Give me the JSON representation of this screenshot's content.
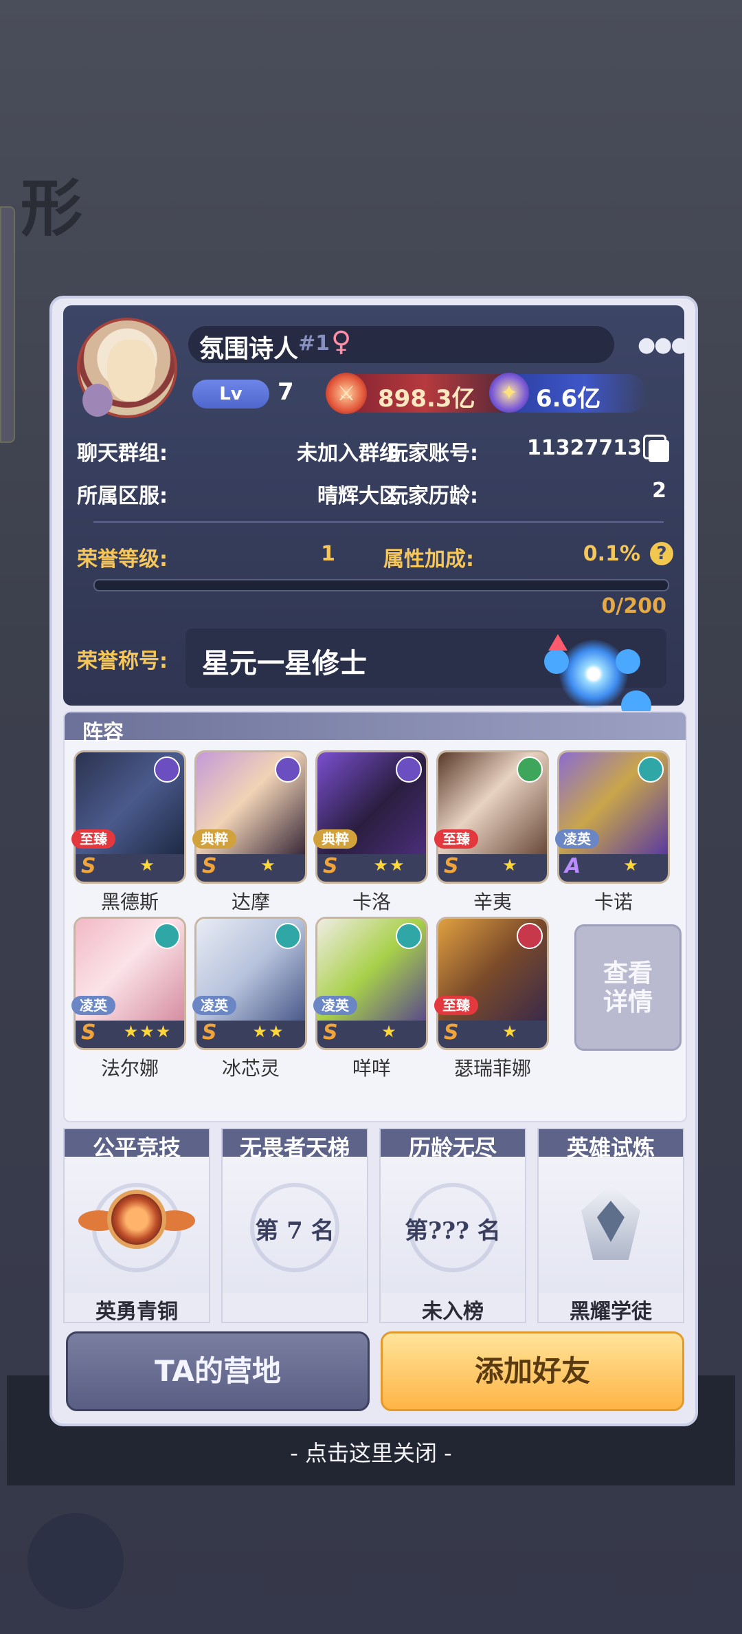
{
  "player": {
    "name": "氛围诗人",
    "rank": "#1",
    "gender_icon": "♀",
    "more_icon": "●●●",
    "level_label": "Lv",
    "level": "7",
    "power": "898.3亿",
    "star_currency": "6.6亿"
  },
  "info": {
    "chat_group_label": "聊天群组:",
    "chat_group_value": "未加入群组",
    "account_label": "玩家账号:",
    "account_value": "11327713",
    "server_label": "所属区服:",
    "server_value": "晴辉大区",
    "age_label": "玩家历龄:",
    "age_value": "2"
  },
  "honor": {
    "level_label": "荣誉等级:",
    "level_value": "1",
    "bonus_label": "属性加成:",
    "bonus_value": "0.1%",
    "help_icon": "?",
    "progress_text": "0/200",
    "progress_fraction": 0.0,
    "title_label": "荣誉称号:",
    "title_value": "星元一星修士"
  },
  "lineup": {
    "title": "阵容",
    "heroes": [
      {
        "name": "黑德斯",
        "tag": "至臻",
        "grade": "S",
        "stars": "★"
      },
      {
        "name": "达摩",
        "tag": "典粹",
        "grade": "S",
        "stars": "★"
      },
      {
        "name": "卡洛",
        "tag": "典粹",
        "grade": "S",
        "stars": "★★"
      },
      {
        "name": "辛夷",
        "tag": "至臻",
        "grade": "S",
        "stars": "★"
      },
      {
        "name": "卡诺",
        "tag": "凌英",
        "grade": "A",
        "stars": "★"
      },
      {
        "name": "法尔娜",
        "tag": "凌英",
        "grade": "S",
        "stars": "★★★"
      },
      {
        "name": "冰芯灵",
        "tag": "凌英",
        "grade": "S",
        "stars": "★★"
      },
      {
        "name": "咩咩",
        "tag": "凌英",
        "grade": "S",
        "stars": "★"
      },
      {
        "name": "瑟瑞菲娜",
        "tag": "至臻",
        "grade": "S",
        "stars": "★"
      }
    ],
    "view_details_line1": "查看",
    "view_details_line2": "详情"
  },
  "rankings": [
    {
      "title": "公平竞技",
      "label": "英勇青铜"
    },
    {
      "title": "无畏者天梯",
      "rank_text": "第 7 名",
      "label": ""
    },
    {
      "title": "历龄无尽",
      "rank_text": "第??? 名",
      "label": "未入榜"
    },
    {
      "title": "英雄试炼",
      "label": "黑耀学徒"
    }
  ],
  "buttons": {
    "camp": "TA的营地",
    "add_friend": "添加好友"
  },
  "close_hint": "- 点击这里关闭 -",
  "colors": {
    "honor_gold": "#f5c65a",
    "modal_bg": "#e7e8f3",
    "header_bg": "#3d4566",
    "add_button": "#ffb446"
  }
}
